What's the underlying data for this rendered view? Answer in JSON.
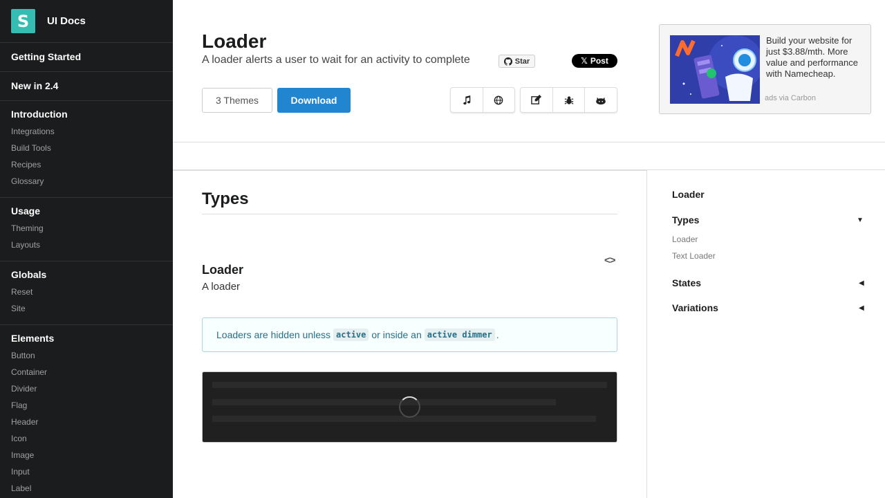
{
  "brand": {
    "logo_letter": "S",
    "name": "UI Docs"
  },
  "sidebar": {
    "sections": [
      {
        "title": "Getting Started",
        "items": []
      },
      {
        "title": "New in 2.4",
        "items": []
      },
      {
        "title": "Introduction",
        "items": [
          "Integrations",
          "Build Tools",
          "Recipes",
          "Glossary"
        ]
      },
      {
        "title": "Usage",
        "items": [
          "Theming",
          "Layouts"
        ]
      },
      {
        "title": "Globals",
        "items": [
          "Reset",
          "Site"
        ]
      },
      {
        "title": "Elements",
        "items": [
          "Button",
          "Container",
          "Divider",
          "Flag",
          "Header",
          "Icon",
          "Image",
          "Input",
          "Label"
        ]
      }
    ]
  },
  "header": {
    "title": "Loader",
    "subtitle": "A loader alerts a user to wait for an activity to complete",
    "star_label": "Star",
    "post_label": "Post",
    "themes_label": "3 Themes",
    "download_label": "Download"
  },
  "ad": {
    "text": "Build your website for just $3.88/mth. More value and performance with Namecheap.",
    "via": "ads via Carbon"
  },
  "main": {
    "section_title": "Types",
    "example_title": "Loader",
    "example_desc": "A loader",
    "code_toggle": "<>",
    "info": {
      "before": "Loaders are hidden unless",
      "code1": "active",
      "middle": "or inside an",
      "code2": "active dimmer",
      "after": "."
    }
  },
  "toc": {
    "title": "Loader",
    "types": "Types",
    "type_items": [
      "Loader",
      "Text Loader"
    ],
    "states": "States",
    "variations": "Variations"
  }
}
